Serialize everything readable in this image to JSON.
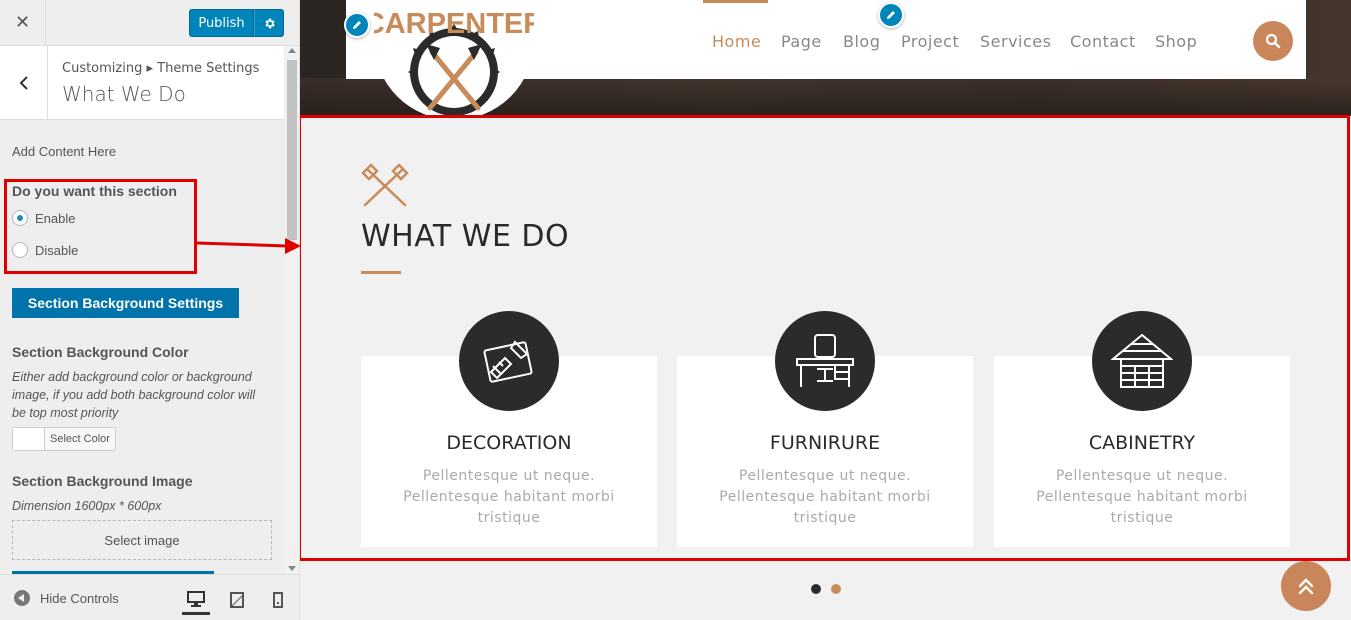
{
  "customizer": {
    "close_label": "✕",
    "publish_label": "Publish",
    "breadcrumb": "Customizing ▸ Theme Settings",
    "panel_title": "What We Do",
    "add_content": "Add Content Here",
    "section_question": "Do you want this section",
    "radio_options": [
      {
        "label": "Enable",
        "checked": true
      },
      {
        "label": "Disable",
        "checked": false
      }
    ],
    "bg_settings_button": "Section Background Settings",
    "bg_color_label": "Section Background Color",
    "bg_color_desc": "Either add background color or background image, if you add both background color will be top most priority",
    "select_color_label": "Select Color",
    "bg_image_label": "Section Background Image",
    "bg_image_desc": "Dimension 1600px * 600px",
    "select_image_label": "Select image",
    "hide_controls": "Hide Controls",
    "devices": [
      "desktop",
      "tablet",
      "mobile"
    ],
    "active_device": "desktop"
  },
  "site": {
    "logo_text": "CARPENTER",
    "nav": [
      "Home",
      "Page",
      "Blog",
      "Project",
      "Services",
      "Contact",
      "Shop"
    ],
    "active_nav": "Home",
    "section_title": "WHAT WE DO",
    "cards": [
      {
        "title": "DECORATION",
        "text": "Pellentesque ut neque. Pellentesque habitant morbi tristique",
        "icon": "drafting-icon"
      },
      {
        "title": "FURNIRURE",
        "text": "Pellentesque ut neque. Pellentesque habitant morbi tristique",
        "icon": "chair-desk-icon"
      },
      {
        "title": "CABINETRY",
        "text": "Pellentesque ut neque. Pellentesque habitant morbi tristique",
        "icon": "house-icon"
      }
    ],
    "slider_dots": 2,
    "active_dot": 0
  },
  "colors": {
    "accent": "#c88b5a",
    "wp_blue": "#0085ba",
    "highlight_red": "#e00000",
    "dark_circle": "#2b2b2b"
  }
}
